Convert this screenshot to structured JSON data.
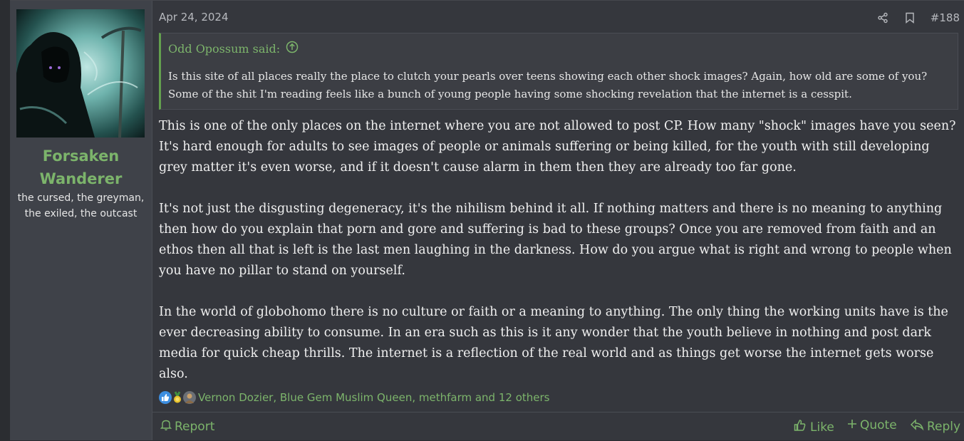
{
  "post": {
    "date": "Apr 24, 2024",
    "number": "#188",
    "author": {
      "name": "Forsaken Wanderer",
      "title": "the cursed, the greyman, the exiled, the outcast"
    },
    "quote": {
      "author_line": "Odd Opossum said:",
      "text": "Is this site of all places really the place to clutch your pearls over teens showing each other shock images? Again, how old are some of you? Some of the shit I'm reading feels like a bunch of young people having some shocking revelation that the internet is a cesspit."
    },
    "paragraphs": [
      "This is one of the only places on the internet where you are not allowed to post CP. How many \"shock\" images have you seen? It's hard enough for adults to see images of people or animals suffering or being killed, for the youth with still developing grey matter it's even worse, and if it doesn't cause alarm in them then they are already too far gone.",
      "It's not just the disgusting degeneracy, it's the nihilism behind it all. If nothing matters and there is no meaning to anything then how do you explain that porn and gore and suffering is bad to these groups? Once you are removed from faith and an ethos then all that is left is the last men laughing in the darkness. How do you argue what is right and wrong to people when you have no pillar to stand on yourself.",
      "In the world of globohomo there is no culture or faith or a meaning to anything. The only thing the working units have is the ever decreasing ability to consume. In an era such as this is it any wonder that the youth believe in nothing and post dark media for quick cheap thrills. The internet is a reflection of the real world and as things get worse the internet gets worse also."
    ],
    "reactions": {
      "icons": [
        "like-reaction-icon",
        "medal-reaction-icon",
        "custom-reaction-icon"
      ],
      "text": "Vernon Dozier, Blue Gem Muslim Queen, methfarm and 12 others"
    },
    "footer": {
      "report": "Report",
      "like": "Like",
      "quote": "Quote",
      "reply": "Reply"
    }
  },
  "colors": {
    "accent": "#7cb46b",
    "post_bg": "#35373d",
    "user_cell_bg": "#3f4249",
    "text": "#f0f0f0"
  }
}
